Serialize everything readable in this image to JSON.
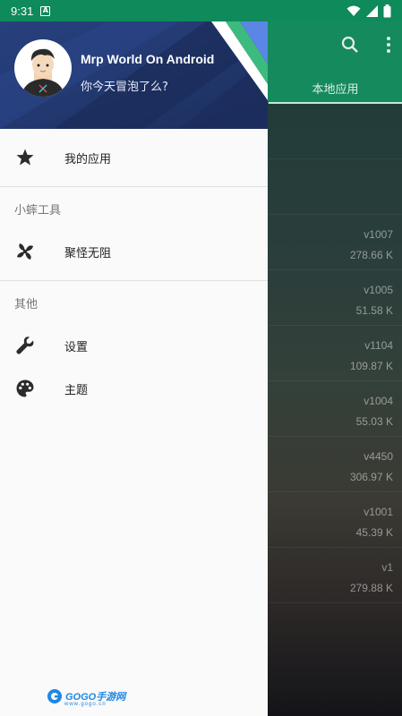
{
  "status_bar": {
    "time": "9:31",
    "notification_icon": "app-notification-icon",
    "icons": [
      "wifi-icon",
      "cell-signal-icon",
      "battery-icon"
    ]
  },
  "app_bar": {
    "tab_label": "本地应用",
    "icons": [
      "search-icon",
      "more-vert-icon"
    ]
  },
  "background_list": [
    {
      "version": "",
      "size": ""
    },
    {
      "version": "",
      "size": ""
    },
    {
      "version": "v1007",
      "size": "278.66 K"
    },
    {
      "version": "v1005",
      "size": "51.58 K"
    },
    {
      "version": "v1104",
      "size": "109.87 K"
    },
    {
      "version": "v1004",
      "size": "55.03 K"
    },
    {
      "version": "v4450",
      "size": "306.97 K"
    },
    {
      "version": "v1001",
      "size": "45.39 K"
    },
    {
      "version": "v1",
      "size": "279.88 K"
    }
  ],
  "drawer": {
    "header": {
      "title": "Mrp World On Android",
      "subtitle": "你今天冒泡了么?"
    },
    "primary_items": [
      {
        "label": "我的应用",
        "icon": "star-icon"
      }
    ],
    "sections": [
      {
        "title": "小蟀工具",
        "items": [
          {
            "label": "聚怪无阻",
            "icon": "pinwheel-icon"
          }
        ]
      },
      {
        "title": "其他",
        "items": [
          {
            "label": "设置",
            "icon": "wrench-icon"
          },
          {
            "label": "主题",
            "icon": "palette-icon"
          }
        ]
      }
    ]
  },
  "watermark": {
    "text": "GOGO手游网",
    "url_text": "www.gogo.cn"
  },
  "colors": {
    "status_bar": "#0f8a5a",
    "app_bar": "#158a5d",
    "drawer_header": "#27407d",
    "drawer_bg": "#fafafa"
  }
}
